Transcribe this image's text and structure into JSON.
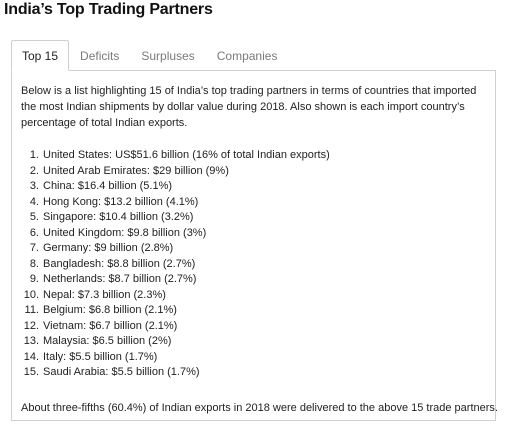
{
  "page": {
    "title": "India’s Top Trading Partners"
  },
  "tabs": [
    {
      "label": "Top 15",
      "active": true
    },
    {
      "label": "Deficits",
      "active": false
    },
    {
      "label": "Surpluses",
      "active": false
    },
    {
      "label": "Companies",
      "active": false
    }
  ],
  "panel": {
    "intro": "Below is a list highlighting 15 of India’s top trading partners in terms of countries that imported the most Indian shipments by dollar value during 2018. Also shown is each import country’s percentage of total Indian exports.",
    "items": [
      {
        "num": "1.",
        "text": "United States: US$51.6 billion (16% of total Indian exports)"
      },
      {
        "num": "2.",
        "text": "United Arab Emirates: $29 billion (9%)"
      },
      {
        "num": "3.",
        "text": "China: $16.4 billion (5.1%)"
      },
      {
        "num": "4.",
        "text": "Hong Kong: $13.2 billion (4.1%)"
      },
      {
        "num": "5.",
        "text": "Singapore: $10.4 billion (3.2%)"
      },
      {
        "num": "6.",
        "text": "United Kingdom: $9.8 billion (3%)"
      },
      {
        "num": "7.",
        "text": "Germany: $9 billion (2.8%)"
      },
      {
        "num": "8.",
        "text": "Bangladesh: $8.8 billion (2.7%)"
      },
      {
        "num": "9.",
        "text": "Netherlands: $8.7 billion (2.7%)"
      },
      {
        "num": "10.",
        "text": "Nepal: $7.3 billion (2.3%)"
      },
      {
        "num": "11.",
        "text": "Belgium: $6.8 billion (2.1%)"
      },
      {
        "num": "12.",
        "text": "Vietnam: $6.7 billion (2.1%)"
      },
      {
        "num": "13.",
        "text": "Malaysia: $6.5 billion (2%)"
      },
      {
        "num": "14.",
        "text": "Italy: $5.5 billion (1.7%)"
      },
      {
        "num": "15.",
        "text": "Saudi Arabia: $5.5 billion (1.7%)"
      }
    ],
    "summary": "About three-fifths (60.4%) of Indian exports in 2018 were delivered to the above 15 trade partners."
  }
}
